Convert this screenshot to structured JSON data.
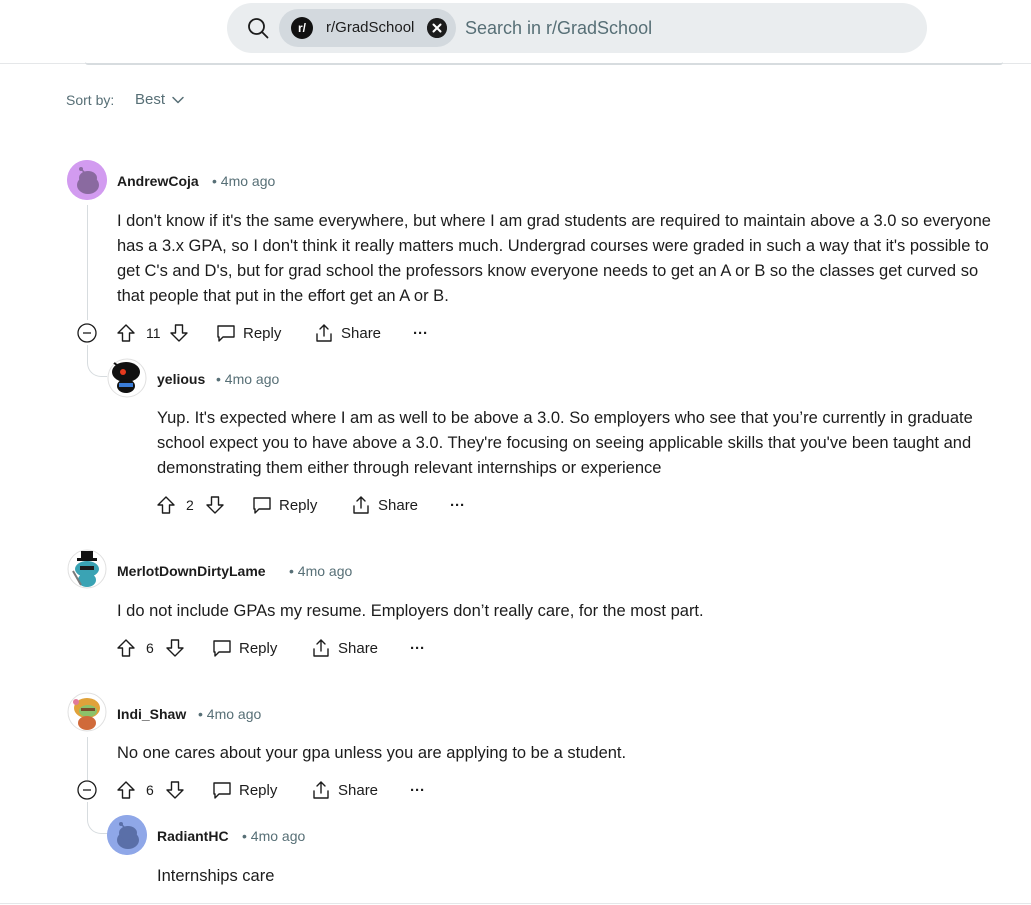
{
  "search": {
    "community_chip": "r/GradSchool",
    "chip_avatar": "r/",
    "placeholder": "Search in r/GradSchool"
  },
  "sort": {
    "label": "Sort by:",
    "value": "Best"
  },
  "actions": {
    "reply": "Reply",
    "share": "Share",
    "more": "···"
  },
  "comments": [
    {
      "author": "AndrewCoja",
      "time": "• 4mo ago",
      "body": "I don't know if it's the same everywhere, but where I am grad students are required to maintain above a 3.0 so everyone has a 3.x GPA, so I don't think it really matters much. Undergrad courses were graded in such a way that it's possible to get C's and D's, but for grad school the professors know everyone needs to get an A or B so the classes get curved so that people that put in the effort get an A or B.",
      "votes": "11",
      "avatar_color": "#d29bf0"
    },
    {
      "author": "yelious",
      "time": "• 4mo ago",
      "body": "Yup. It's expected where I am as well to be above a 3.0. So employers who see that you’re currently in graduate school expect you to have above a 3.0. They're focusing on seeing applicable skills that you've been taught and demonstrating them either through relevant internships or experience",
      "votes": "2",
      "avatar_color": "#ffffff"
    },
    {
      "author": "MerlotDownDirtyLame",
      "time": "• 4mo ago",
      "body": "I do not include GPAs my resume. Employers don’t really care, for the most part.",
      "votes": "6",
      "avatar_color": "#ffffff"
    },
    {
      "author": "Indi_Shaw",
      "time": "• 4mo ago",
      "body": "No one cares about your gpa unless you are applying to be a student.",
      "votes": "6",
      "avatar_color": "#ffffff"
    },
    {
      "author": "RadiantHC",
      "time": "• 4mo ago",
      "body": "Internships care",
      "avatar_color": "#8fa7e8"
    }
  ]
}
